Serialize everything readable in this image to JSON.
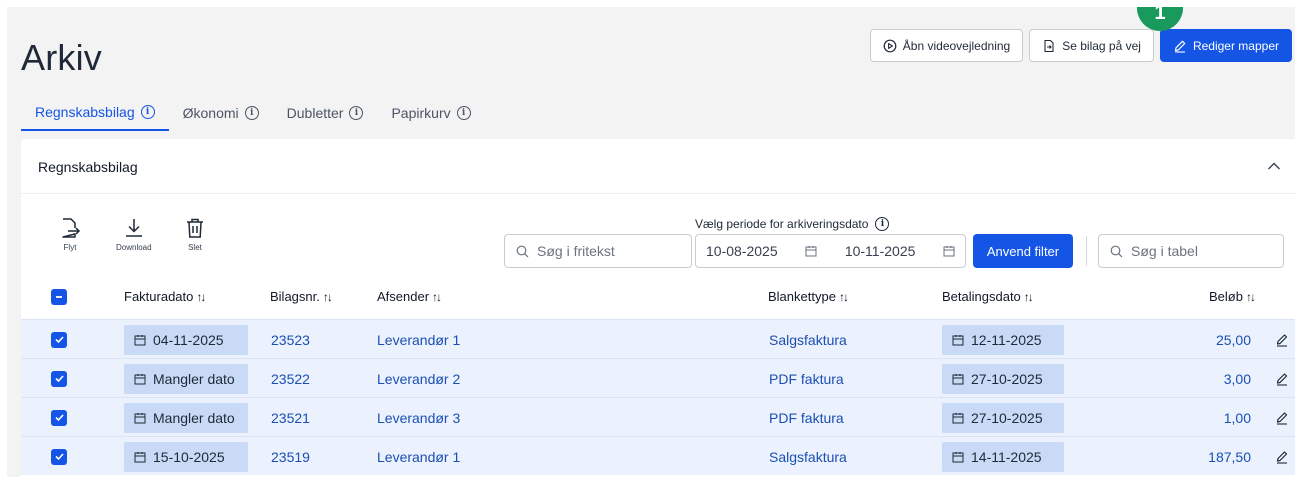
{
  "page": {
    "title": "Arkiv",
    "step_badge": "1"
  },
  "top_actions": {
    "video_label": "Åbn videovejledning",
    "onway_label": "Se bilag på vej",
    "edit_folders_label": "Rediger mapper"
  },
  "tabs": [
    {
      "label": "Regnskabsbilag",
      "active": true
    },
    {
      "label": "Økonomi",
      "active": false
    },
    {
      "label": "Dubletter",
      "active": false
    },
    {
      "label": "Papirkurv",
      "active": false
    }
  ],
  "card": {
    "title": "Regnskabsbilag"
  },
  "toolbar": {
    "move": "Flyt",
    "download": "Download",
    "delete": "Slet"
  },
  "filters": {
    "freetext_placeholder": "Søg i fritekst",
    "period_label": "Vælg periode for arkiveringsdato",
    "date_from": "10-08-2025",
    "date_to": "10-11-2025",
    "apply_label": "Anvend filter",
    "table_search_placeholder": "Søg i tabel"
  },
  "table": {
    "headers": {
      "invoice_date": "Fakturadato",
      "voucher_no": "Bilagsnr.",
      "sender": "Afsender",
      "form_type": "Blankettype",
      "payment_date": "Betalingsdato",
      "amount": "Beløb"
    },
    "rows": [
      {
        "invoice_date": "04-11-2025",
        "voucher_no": "23523",
        "sender": "Leverandør 1",
        "form_type": "Salgsfaktura",
        "payment_date": "12-11-2025",
        "amount": "25,00"
      },
      {
        "invoice_date": "Mangler dato",
        "voucher_no": "23522",
        "sender": "Leverandør 2",
        "form_type": "PDF faktura",
        "payment_date": "27-10-2025",
        "amount": "3,00"
      },
      {
        "invoice_date": "Mangler dato",
        "voucher_no": "23521",
        "sender": "Leverandør 3",
        "form_type": "PDF faktura",
        "payment_date": "27-10-2025",
        "amount": "1,00"
      },
      {
        "invoice_date": "15-10-2025",
        "voucher_no": "23519",
        "sender": "Leverandør 1",
        "form_type": "Salgsfaktura",
        "payment_date": "14-11-2025",
        "amount": "187,50"
      }
    ]
  },
  "colors": {
    "accent": "#1455e6",
    "row_selected": "#ebf2fd",
    "date_chip": "#c8daf6",
    "badge": "#199a5c"
  }
}
